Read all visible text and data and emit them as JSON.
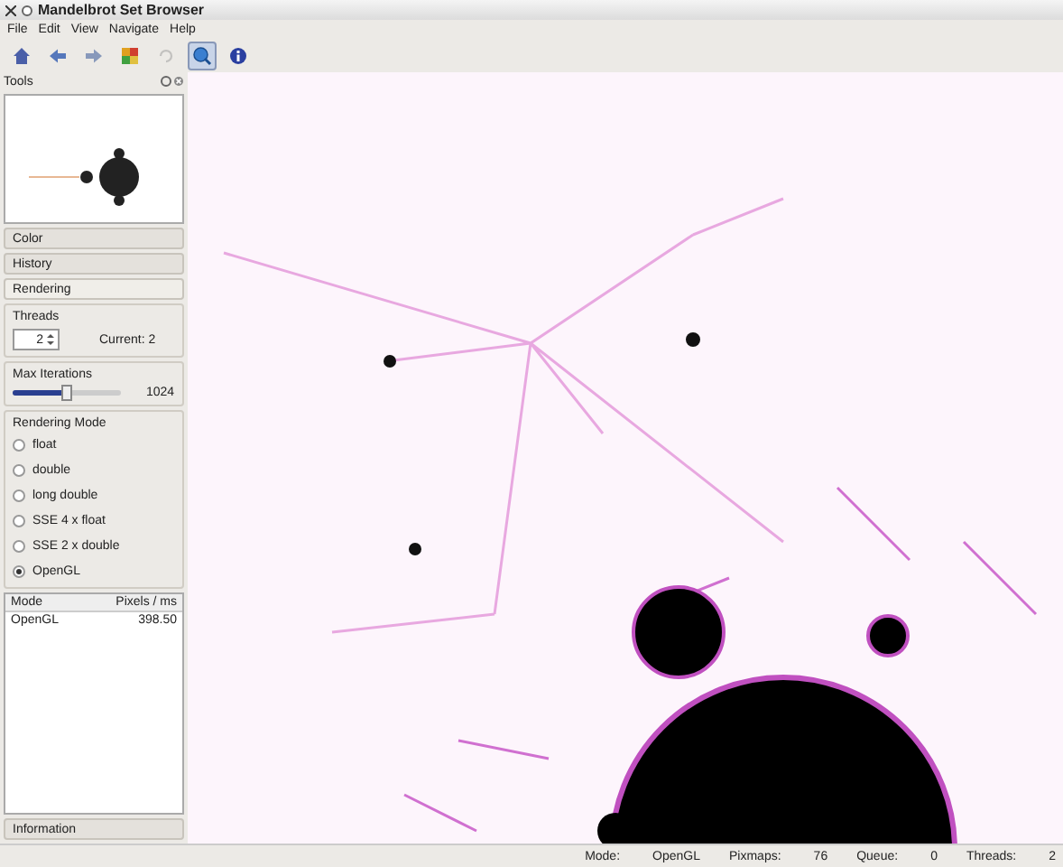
{
  "window": {
    "title": "Mandelbrot Set Browser"
  },
  "menu": [
    "File",
    "Edit",
    "View",
    "Navigate",
    "Help"
  ],
  "toolbar": [
    {
      "kind": "home",
      "pressed": false,
      "disabled": false
    },
    {
      "kind": "back",
      "pressed": false,
      "disabled": false
    },
    {
      "kind": "forward",
      "pressed": false,
      "disabled": false
    },
    {
      "kind": "palette",
      "pressed": false,
      "disabled": false
    },
    {
      "kind": "refresh",
      "pressed": false,
      "disabled": true
    },
    {
      "kind": "zoom",
      "pressed": true,
      "disabled": false
    },
    {
      "kind": "info",
      "pressed": false,
      "disabled": false
    }
  ],
  "tools_panel": {
    "title": "Tools",
    "sections": [
      {
        "label": "Color",
        "expanded": false
      },
      {
        "label": "History",
        "expanded": false
      },
      {
        "label": "Rendering",
        "expanded": true
      }
    ],
    "threads": {
      "title": "Threads",
      "value": "2",
      "current": "Current: 2"
    },
    "max_iterations": {
      "title": "Max Iterations",
      "level": 0.5,
      "reading": "1024"
    },
    "rendering_mode": {
      "title": "Rendering Mode",
      "options": [
        {
          "label": "float",
          "selected": false
        },
        {
          "label": "double",
          "selected": false
        },
        {
          "label": "long double",
          "selected": false
        },
        {
          "label": "SSE 4 x float",
          "selected": false
        },
        {
          "label": "SSE 2 x double",
          "selected": false
        },
        {
          "label": "OpenGL",
          "selected": true
        }
      ]
    },
    "table": {
      "columns": [
        "Mode",
        "Pixels / ms"
      ],
      "rows": [
        [
          "OpenGL",
          "398.50"
        ]
      ]
    },
    "footer_section": {
      "label": "Information",
      "expanded": false
    }
  },
  "status_bar": [
    {
      "label": "Mode:",
      "value": "OpenGL"
    },
    {
      "label": "Pixmaps:",
      "value": "76"
    },
    {
      "label": "Queue:",
      "value": "0"
    },
    {
      "label": "Threads:",
      "value": "2"
    }
  ]
}
